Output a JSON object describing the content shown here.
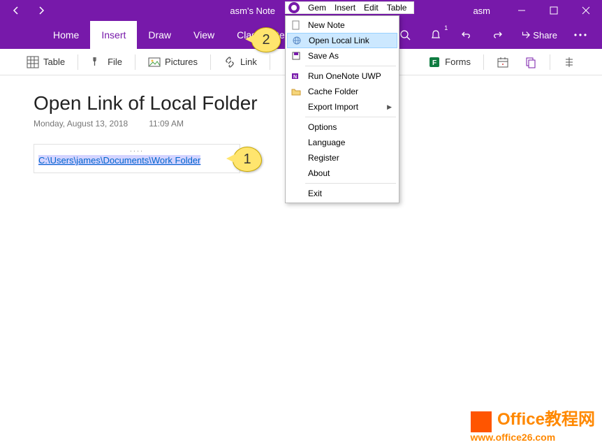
{
  "titlebar": {
    "title": "asm's Note",
    "user": "asm"
  },
  "tabs": {
    "home": "Home",
    "insert": "Insert",
    "draw": "Draw",
    "view": "View",
    "class": "Class Notebook"
  },
  "ribbon_right": {
    "bell_badge": "1",
    "share": "Share"
  },
  "toolbar": {
    "table": "Table",
    "file": "File",
    "pictures": "Pictures",
    "link": "Link",
    "forms": "Forms"
  },
  "page": {
    "title": "Open Link of Local Folder",
    "date": "Monday, August 13, 2018",
    "time": "11:09 AM",
    "handle": "....",
    "link_path": "C:\\Users\\james\\Documents\\Work Folder"
  },
  "gem_menu": {
    "gem": "Gem",
    "insert": "Insert",
    "edit": "Edit",
    "table": "Table"
  },
  "dropdown": {
    "new_note": "New Note",
    "open_local_link": "Open Local Link",
    "save_as": "Save As",
    "run_onenote_uwp": "Run OneNote UWP",
    "cache_folder": "Cache Folder",
    "export_import": "Export Import",
    "options": "Options",
    "language": "Language",
    "register": "Register",
    "about": "About",
    "exit": "Exit"
  },
  "callouts": {
    "one": "1",
    "two": "2"
  },
  "watermark": {
    "line1": "Office教程网",
    "line2": "www.office26.com"
  }
}
